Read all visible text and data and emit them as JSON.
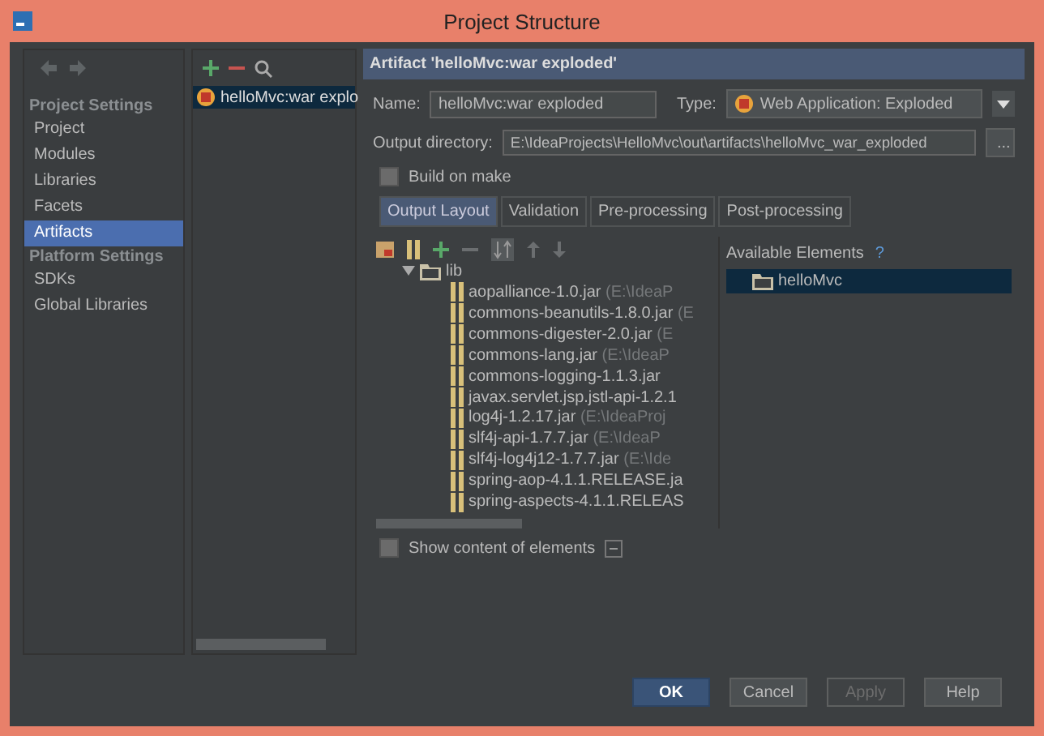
{
  "window": {
    "title": "Project Structure"
  },
  "sidebar": {
    "sections": [
      {
        "header": "Project Settings",
        "items": [
          {
            "label": "Project",
            "selected": false
          },
          {
            "label": "Modules",
            "selected": false
          },
          {
            "label": "Libraries",
            "selected": false
          },
          {
            "label": "Facets",
            "selected": false
          },
          {
            "label": "Artifacts",
            "selected": true
          }
        ]
      },
      {
        "header": "Platform Settings",
        "items": [
          {
            "label": "SDKs",
            "selected": false
          },
          {
            "label": "Global Libraries",
            "selected": false
          }
        ]
      }
    ]
  },
  "artifacts_list": {
    "items": [
      {
        "label": "helloMvc:war explo",
        "selected": true
      }
    ]
  },
  "artifact": {
    "header": "Artifact 'helloMvc:war exploded'",
    "name_label": "Name:",
    "name_value": "helloMvc:war exploded",
    "type_label": "Type:",
    "type_value": "Web Application: Exploded",
    "output_label": "Output directory:",
    "output_value": "E:\\IdeaProjects\\HelloMvc\\out\\artifacts\\helloMvc_war_exploded",
    "browse": "...",
    "build_on_make": {
      "label": "Build on make",
      "checked": false
    },
    "tabs": [
      {
        "label": "Output Layout",
        "selected": true
      },
      {
        "label": "Validation",
        "selected": false
      },
      {
        "label": "Pre-processing",
        "selected": false
      },
      {
        "label": "Post-processing",
        "selected": false
      }
    ],
    "layout_tree": {
      "label": "lib",
      "expanded": true,
      "children": [
        {
          "name": "aopalliance-1.0.jar",
          "path": "(E:\\IdeaP"
        },
        {
          "name": "commons-beanutils-1.8.0.jar",
          "path": "(E"
        },
        {
          "name": "commons-digester-2.0.jar",
          "path": "(E"
        },
        {
          "name": "commons-lang.jar",
          "path": "(E:\\IdeaP"
        },
        {
          "name": "commons-logging-1.1.3.jar"
        },
        {
          "name": "javax.servlet.jsp.jstl-api-1.2.1"
        },
        {
          "name": "log4j-1.2.17.jar",
          "path": "(E:\\IdeaProj"
        },
        {
          "name": "slf4j-api-1.7.7.jar",
          "path": "(E:\\IdeaP"
        },
        {
          "name": "slf4j-log4j12-1.7.7.jar",
          "path": "(E:\\Ide"
        },
        {
          "name": "spring-aop-4.1.1.RELEASE.ja"
        },
        {
          "name": "spring-aspects-4.1.1.RELEAS"
        }
      ]
    },
    "available_elements": {
      "title": "Available Elements",
      "help": "?",
      "items": [
        {
          "label": "helloMvc",
          "selected": true
        }
      ]
    },
    "show_content": {
      "label": "Show content of elements",
      "checked": false
    }
  },
  "buttons": [
    {
      "label": "OK",
      "kind": "default"
    },
    {
      "label": "Cancel",
      "kind": "normal"
    },
    {
      "label": "Apply",
      "kind": "disabled"
    },
    {
      "label": "Help",
      "kind": "normal"
    }
  ]
}
